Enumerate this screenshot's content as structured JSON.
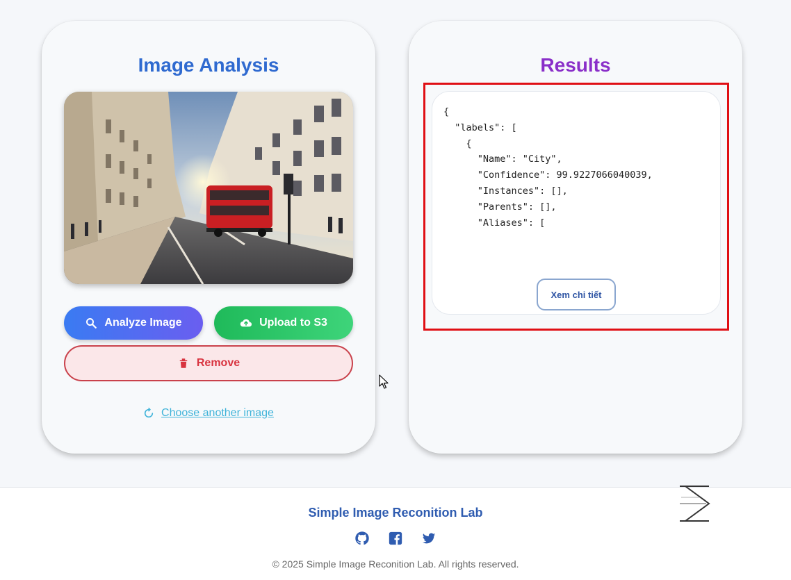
{
  "left_card": {
    "title": "Image Analysis",
    "photo_alt": "Street with red double-decker bus",
    "analyze_label": "Analyze Image",
    "upload_label": "Upload to S3",
    "remove_label": "Remove",
    "choose_another_label": "Choose another image"
  },
  "right_card": {
    "title": "Results",
    "json_text": "{\n  \"labels\": [\n    {\n      \"Name\": \"City\",\n      \"Confidence\": 99.9227066040039,\n      \"Instances\": [],\n      \"Parents\": [],\n      \"Aliases\": [",
    "detail_label": "Xem chi tiết"
  },
  "footer": {
    "title": "Simple Image Reconition Lab",
    "copyright": "© 2025 Simple Image Reconition Lab. All rights reserved.",
    "socials": [
      "github-icon",
      "facebook-icon",
      "twitter-icon"
    ]
  },
  "colors": {
    "accent_blue": "#2f6ad0",
    "accent_purple": "#8a2fc9",
    "success_green": "#1fba5a",
    "danger_red": "#d8333f",
    "highlight_frame": "#e00f14"
  }
}
